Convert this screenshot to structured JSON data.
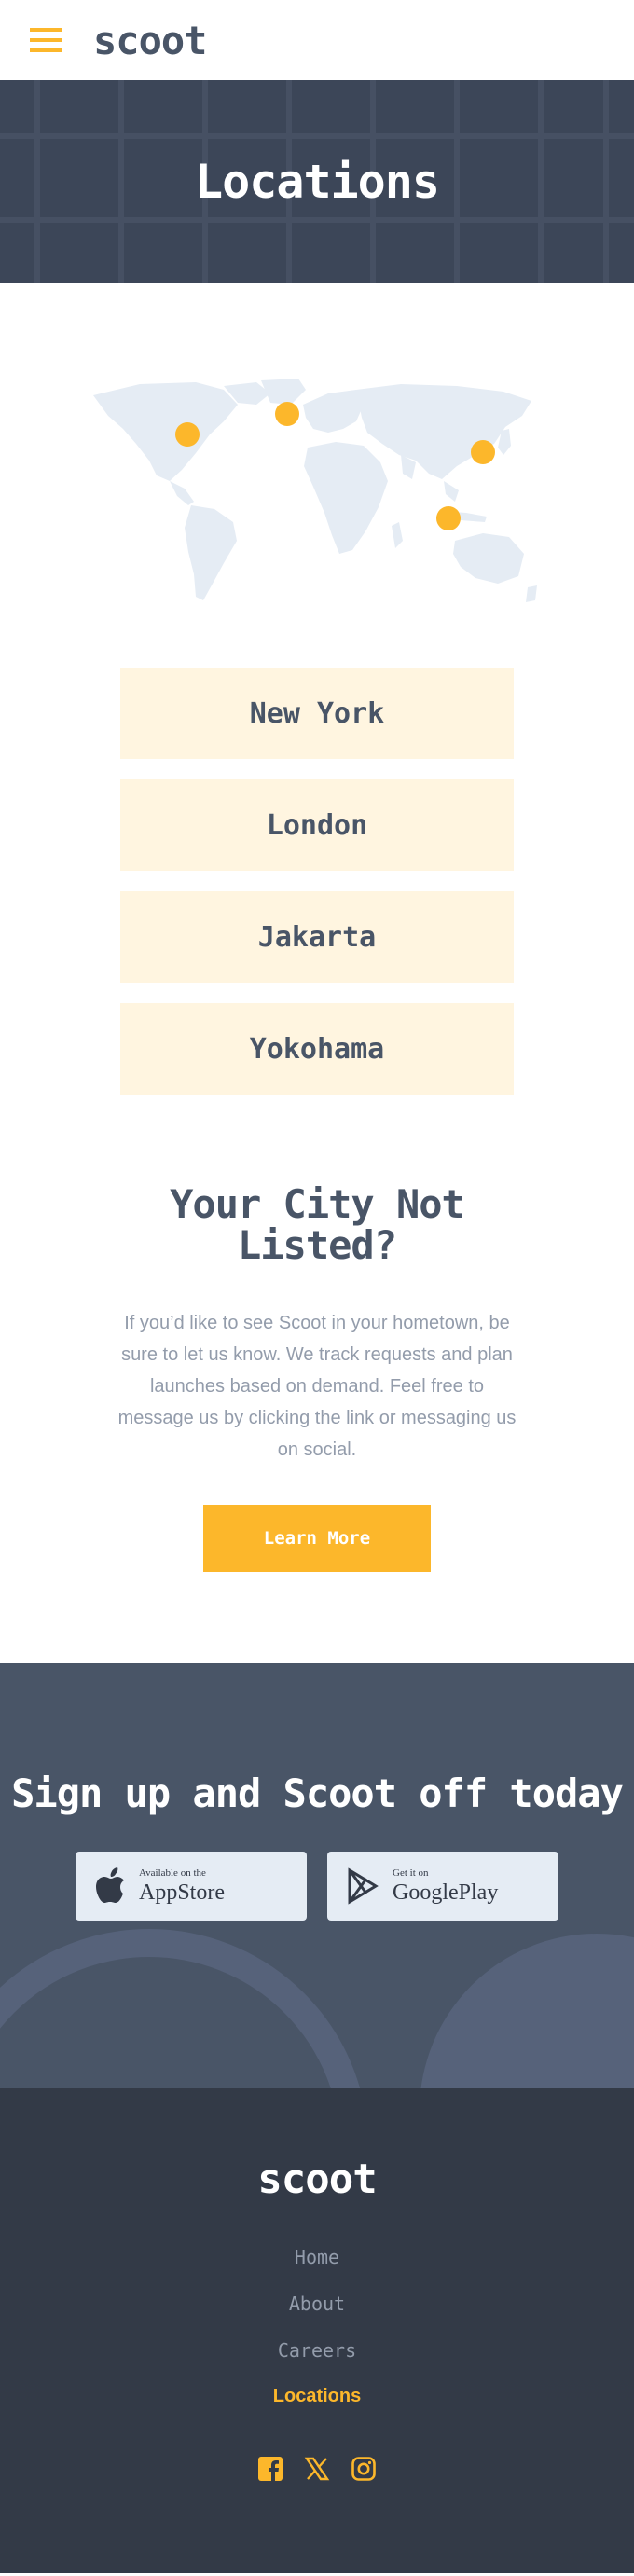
{
  "header": {
    "logo": "scoot",
    "menu_icon": "hamburger-icon"
  },
  "hero": {
    "title": "Locations"
  },
  "map": {
    "alt": "world-map",
    "pin_color": "#fcb72b"
  },
  "locations": [
    {
      "name": "New York"
    },
    {
      "name": "London"
    },
    {
      "name": "Jakarta"
    },
    {
      "name": "Yokohama"
    }
  ],
  "not_listed": {
    "title": "Your City Not Listed?",
    "body": "If you’d like to see Scoot in your hometown, be sure to let us know. We track requests and plan launches based on demand. Feel free to message us by clicking the link or messaging us on social.",
    "button": "Learn More"
  },
  "signup": {
    "title": "Sign up and Scoot off today",
    "appstore": {
      "small": "Available on the",
      "big": "AppStore"
    },
    "googleplay": {
      "small": "Get it on",
      "big": "GooglePlay"
    }
  },
  "footer": {
    "logo": "scoot",
    "nav": [
      {
        "label": "Home"
      },
      {
        "label": "About"
      },
      {
        "label": "Careers"
      },
      {
        "label": "Locations"
      }
    ],
    "socials": [
      "facebook-icon",
      "twitter-icon",
      "instagram-icon"
    ]
  },
  "colors": {
    "accent": "#fcb72b",
    "dark": "#333a47",
    "slate": "#495567",
    "cream": "#fff5e0"
  }
}
